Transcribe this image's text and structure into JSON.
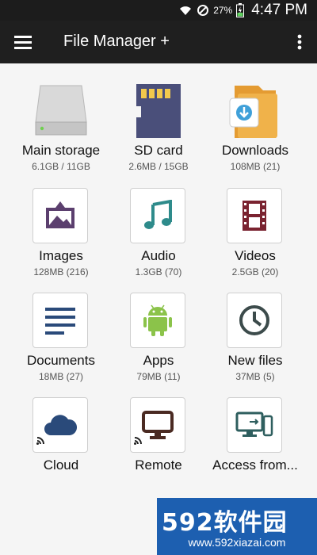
{
  "status": {
    "battery": "27%",
    "time": "4:47 PM"
  },
  "appbar": {
    "title": "File Manager +"
  },
  "items": [
    {
      "label": "Main storage",
      "sub": "6.1GB / 11GB"
    },
    {
      "label": "SD card",
      "sub": "2.6MB / 15GB"
    },
    {
      "label": "Downloads",
      "sub": "108MB (21)"
    },
    {
      "label": "Images",
      "sub": "128MB (216)"
    },
    {
      "label": "Audio",
      "sub": "1.3GB (70)"
    },
    {
      "label": "Videos",
      "sub": "2.5GB (20)"
    },
    {
      "label": "Documents",
      "sub": "18MB (27)"
    },
    {
      "label": "Apps",
      "sub": "79MB (11)"
    },
    {
      "label": "New files",
      "sub": "37MB (5)"
    },
    {
      "label": "Cloud",
      "sub": ""
    },
    {
      "label": "Remote",
      "sub": ""
    },
    {
      "label": "Access from...",
      "sub": ""
    }
  ],
  "watermark": {
    "logo": "592软件园",
    "url": "www.592xiazai.com"
  },
  "colors": {
    "accent_teal": "#2e8b8b",
    "navy": "#2a4a7a",
    "purple": "#5b3f6e",
    "maroon": "#7a2330",
    "android_green": "#8bc34a",
    "folder_orange": "#f0b24a"
  }
}
